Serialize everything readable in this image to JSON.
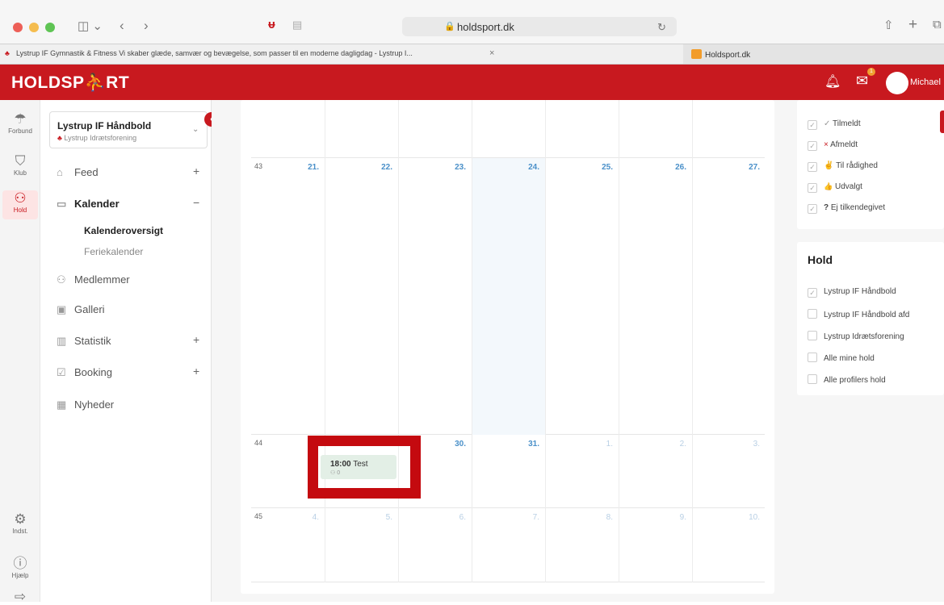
{
  "browser": {
    "url": "holdsport.dk",
    "tabs": [
      {
        "label": "Lystrup IF Gymnastik & Fitness Vi skaber glæde, samvær og bevægelse, som passer til en moderne dagligdag - Lystrup I...",
        "close": "×"
      },
      {
        "label": "Holdsport.dk"
      }
    ]
  },
  "header": {
    "logo": "HOLDSP⛹RT",
    "user": "Michael",
    "notification_count": "1"
  },
  "rail": [
    {
      "label": "Forbund",
      "icon": "umbrella-icon"
    },
    {
      "label": "Klub",
      "icon": "shield-icon"
    },
    {
      "label": "Hold",
      "icon": "team-icon"
    },
    {
      "label": "Indst.",
      "icon": "gear-icon"
    },
    {
      "label": "Hjælp",
      "icon": "help-icon"
    },
    {
      "label": "",
      "icon": "logout-icon"
    }
  ],
  "sidebar": {
    "club_name": "Lystrup IF Håndbold",
    "club_sub": "Lystrup Idrætsforening",
    "nav": [
      {
        "label": "Feed",
        "icon": "home-icon",
        "plus": "+"
      },
      {
        "label": "Kalender",
        "icon": "calendar-icon",
        "plus": "−"
      },
      {
        "label": "Kalenderoversigt"
      },
      {
        "label": "Feriekalender"
      },
      {
        "label": "Medlemmer",
        "icon": "members-icon"
      },
      {
        "label": "Galleri",
        "icon": "gallery-icon"
      },
      {
        "label": "Statistik",
        "icon": "stats-icon",
        "plus": "+"
      },
      {
        "label": "Booking",
        "icon": "booking-icon",
        "plus": "+"
      },
      {
        "label": "Nyheder",
        "icon": "news-icon"
      }
    ]
  },
  "calendar": {
    "weeks": [
      {
        "num": "",
        "days": [
          "",
          "",
          "",
          "",
          "",
          "",
          ""
        ]
      },
      {
        "num": "43",
        "days": [
          "21.",
          "22.",
          "23.",
          "24.",
          "25.",
          "26.",
          "27."
        ]
      },
      {
        "num": "44",
        "days": [
          "",
          "",
          "30.",
          "31.",
          "1.",
          "2.",
          "3."
        ]
      },
      {
        "num": "45",
        "days": [
          "4.",
          "5.",
          "6.",
          "7.",
          "8.",
          "9.",
          "10."
        ]
      }
    ],
    "event": {
      "time": "18:00",
      "title": "Test",
      "count": "0"
    }
  },
  "filters": {
    "status": [
      {
        "label": "Tilmeldt",
        "symbol": "✓"
      },
      {
        "label": "Afmeldt",
        "symbol": "×"
      },
      {
        "label": "Til rådighed",
        "symbol": "✌"
      },
      {
        "label": "Udvalgt",
        "symbol": "👍"
      },
      {
        "label": "Ej tilkendegivet",
        "symbol": "?"
      }
    ],
    "hold_title": "Hold",
    "hold": [
      {
        "label": "Lystrup IF Håndbold",
        "checked": true
      },
      {
        "label": "Lystrup IF Håndbold afd",
        "checked": false
      },
      {
        "label": "Lystrup Idrætsforening",
        "checked": false
      },
      {
        "label": "Alle mine hold",
        "checked": false
      },
      {
        "label": "Alle profilers hold",
        "checked": false
      }
    ]
  },
  "colors": {
    "brand": "#c8191f",
    "day_link": "#4a90c9",
    "event_bg": "#e3efe6"
  }
}
